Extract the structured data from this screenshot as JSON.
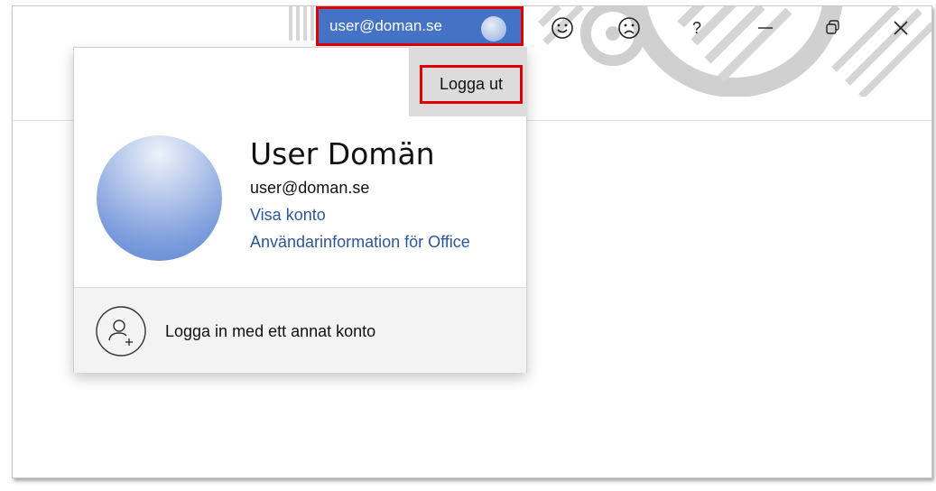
{
  "titlebar": {
    "account_email": "user@doman.se",
    "icons": [
      "smile-icon",
      "frown-icon",
      "help-icon",
      "minimize-icon",
      "restore-icon",
      "close-icon"
    ],
    "help_glyph": "?"
  },
  "popup": {
    "signout_label": "Logga ut",
    "user_name": "User Domän",
    "user_email": "user@doman.se",
    "view_account_label": "Visa konto",
    "office_user_info_label": "Användarinformation för Office",
    "other_account_label": "Logga in med ett annat konto"
  },
  "colors": {
    "accent": "#4472c4",
    "link": "#2b579a",
    "highlight_border": "#e00000"
  }
}
